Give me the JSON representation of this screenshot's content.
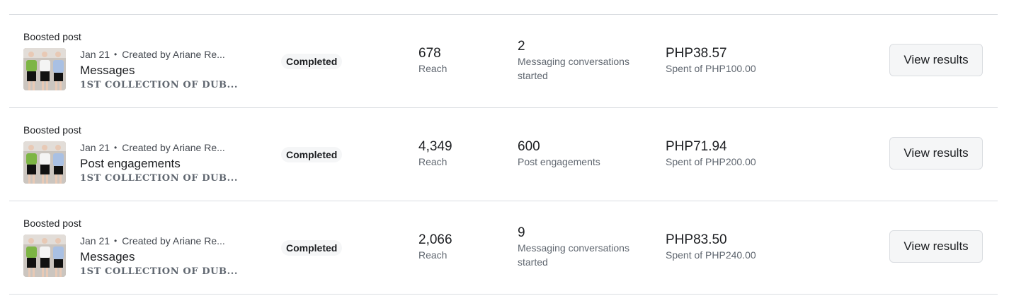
{
  "rows": [
    {
      "kind": "Boosted post",
      "date": "Jan 21",
      "created_by": "Created by Ariane Re...",
      "goal": "Messages",
      "post_text": "1ST COLLECTION OF DUB...",
      "status": "Completed",
      "reach_value": "678",
      "reach_label": "Reach",
      "result_value": "2",
      "result_label": "Messaging conversations started",
      "spent_value": "PHP38.57",
      "spent_label": "Spent of PHP100.00",
      "button_label": "View results"
    },
    {
      "kind": "Boosted post",
      "date": "Jan 21",
      "created_by": "Created by Ariane Re...",
      "goal": "Post engagements",
      "post_text": "1ST COLLECTION OF DUB...",
      "status": "Completed",
      "reach_value": "4,349",
      "reach_label": "Reach",
      "result_value": "600",
      "result_label": "Post engagements",
      "spent_value": "PHP71.94",
      "spent_label": "Spent of PHP200.00",
      "button_label": "View results"
    },
    {
      "kind": "Boosted post",
      "date": "Jan 21",
      "created_by": "Created by Ariane Re...",
      "goal": "Messages",
      "post_text": "1ST COLLECTION OF DUB...",
      "status": "Completed",
      "reach_value": "2,066",
      "reach_label": "Reach",
      "result_value": "9",
      "result_label": "Messaging conversations started",
      "spent_value": "PHP83.50",
      "spent_label": "Spent of PHP240.00",
      "button_label": "View results"
    }
  ],
  "meta_separator": "•",
  "colors": {
    "divider": "#dadde1",
    "status_badge_bg": "#f5f6f7",
    "button_bg": "#f5f6f7",
    "secondary_text": "#606770"
  }
}
